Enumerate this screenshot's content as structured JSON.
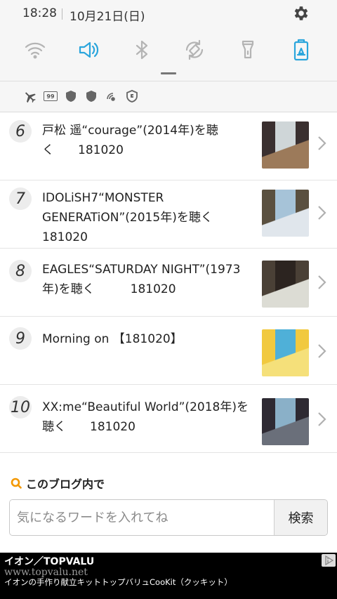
{
  "status_bar": {
    "time": "18:28",
    "date": "10月21日(日)"
  },
  "quick_settings": [
    {
      "name": "wifi-icon",
      "active": false
    },
    {
      "name": "sound-icon",
      "active": true
    },
    {
      "name": "bluetooth-icon",
      "active": false
    },
    {
      "name": "auto-rotate-icon",
      "active": false
    },
    {
      "name": "flashlight-icon",
      "active": false
    },
    {
      "name": "power-saving-icon",
      "active": true
    }
  ],
  "tray_icons": [
    "airplane-icon",
    "battery-99-icon",
    "shield-icon",
    "shield-icon",
    "nfc-on-icon",
    "security-icon"
  ],
  "tray_battery_label": "99",
  "colors": {
    "accent": "#2aa5dc",
    "inactive_icon": "#b4b4b4",
    "search_icon": "#f39800"
  },
  "list": [
    {
      "rank": "6",
      "title": "戸松 遥“courage”(2014年)を聴\nく　　181020",
      "thumb": [
        "#3a3030",
        "#cfd6d8",
        "#9c7a5a"
      ]
    },
    {
      "rank": "7",
      "title": "IDOLiSH7“MONSTER\nGENERATiON”(2015年)を聴く\n181020",
      "thumb": [
        "#5a5040",
        "#a6c3d8",
        "#e0e6ec"
      ]
    },
    {
      "rank": "8",
      "title": "EAGLES“SATURDAY NIGHT”(1973\n年)を聴く　　　181020",
      "thumb": [
        "#4a4036",
        "#2c2420",
        "#dcdcd4"
      ]
    },
    {
      "rank": "9",
      "title": "Morning on 【181020】",
      "thumb": [
        "#f1c93f",
        "#4fb0d8",
        "#f5e07a"
      ]
    },
    {
      "rank": "10",
      "title": "XX:me“Beautiful World”(2018年)を\n聴く　　181020",
      "thumb": [
        "#2e2a33",
        "#8ab0c8",
        "#6a6f7a"
      ]
    }
  ],
  "blog_search": {
    "heading": "このブログ内で",
    "placeholder": "気になるワードを入れてね",
    "button": "検索"
  },
  "ad": {
    "brand": "イオン／TOPVALU",
    "url": "www.topvalu.net",
    "description": "イオンの手作り献立キットトップバリュCooKit（クッキット）"
  }
}
